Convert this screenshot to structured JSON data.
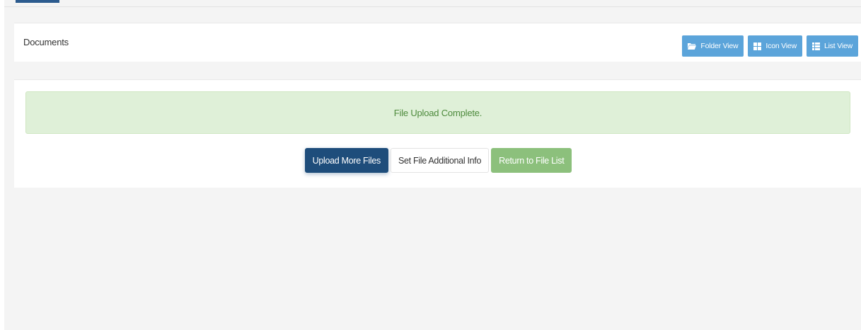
{
  "header": {
    "title": "Documents",
    "view_buttons": {
      "folder": {
        "label": "Folder View",
        "icon": "folder-icon"
      },
      "icon": {
        "label": "Icon View",
        "icon": "grid-icon"
      },
      "list": {
        "label": "List View",
        "icon": "list-icon"
      }
    }
  },
  "alert": {
    "message": "File Upload Complete."
  },
  "actions": {
    "upload_more": "Upload More Files",
    "set_info": "Set File Additional Info",
    "return_list": "Return to File List"
  },
  "colors": {
    "view_button": "#5ba4da",
    "primary": "#1e4d7b",
    "success_button": "#8cc07c",
    "alert_bg": "#dff0d8",
    "alert_text": "#4d8a3c"
  }
}
